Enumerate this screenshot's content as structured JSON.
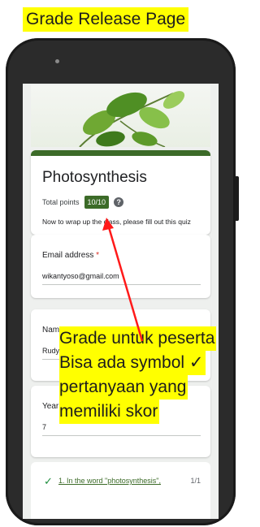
{
  "banner": {
    "title": "Grade Release Page"
  },
  "form": {
    "title": "Photosynthesis",
    "total_points_label": "Total points",
    "score": "10/10",
    "help_glyph": "?",
    "description": "Now to wrap up the class, please fill out this quiz",
    "accent_color": "#3c6b28"
  },
  "fields": {
    "email": {
      "label": "Email address",
      "required_marker": "*",
      "value": "wikantyoso@gmail.com"
    },
    "name": {
      "label": "Name",
      "required_marker": "*",
      "value": "Rudy"
    },
    "year": {
      "label": "Year",
      "required_marker": "*",
      "value": "7"
    }
  },
  "question": {
    "check_glyph": "✓",
    "text": "1. In the word \"photosynthesis\",",
    "score": "1/1"
  },
  "annotation": {
    "lines": [
      "Grade untuk peserta",
      "Bisa ada symbol ✓",
      "pertanyaan yang",
      "memiliki skor"
    ]
  },
  "icons": {
    "help": "help-circle-icon",
    "check": "check-icon",
    "feedback": "feedback-icon"
  }
}
